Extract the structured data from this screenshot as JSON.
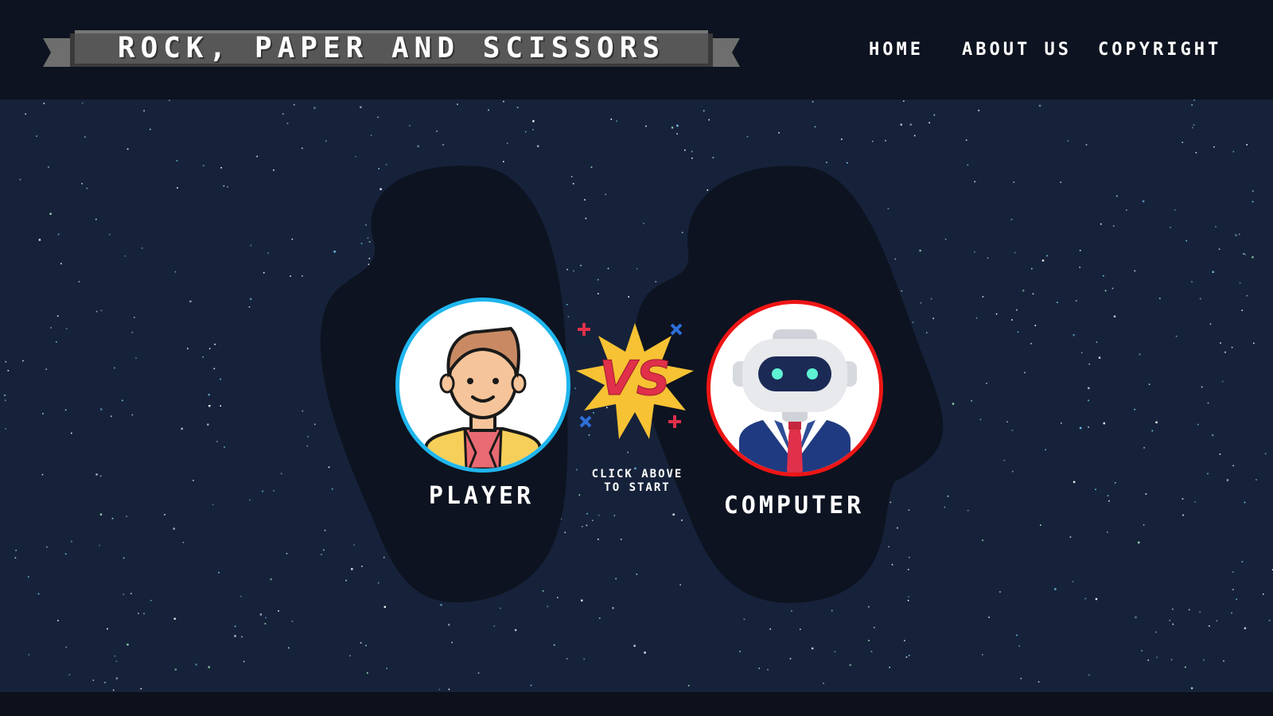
{
  "header": {
    "title": "ROCK, PAPER AND SCISSORS",
    "nav": [
      "HOME",
      "ABOUT US",
      "COPYRIGHT"
    ]
  },
  "game": {
    "player_label": "PLAYER",
    "computer_label": "COMPUTER",
    "vs_text": "VS",
    "hint_line1": "CLICK ABOVE",
    "hint_line2": "TO START"
  },
  "colors": {
    "background": "#16223a",
    "header": "#0d1320",
    "player_ring": "#1fb6ee",
    "computer_ring": "#ee1515",
    "vs_star": "#f7c233",
    "vs_text": "#e0304a"
  }
}
